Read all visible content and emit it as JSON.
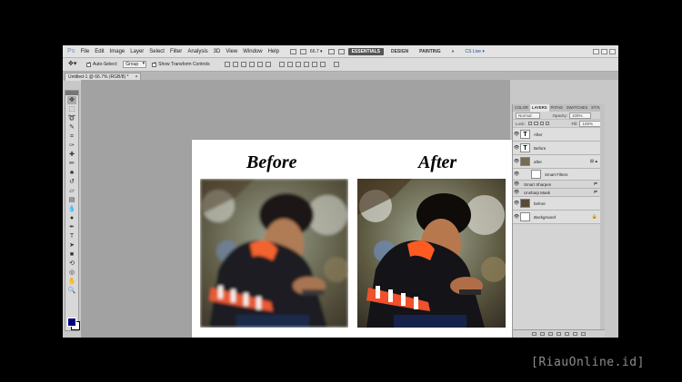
{
  "app": {
    "logo": "Ps",
    "menu": [
      "File",
      "Edit",
      "Image",
      "Layer",
      "Select",
      "Filter",
      "Analysis",
      "3D",
      "View",
      "Window",
      "Help"
    ],
    "zoom": "66.7",
    "workspaces": [
      "ESSENTIALS",
      "DESIGN",
      "PAINTING",
      "»"
    ],
    "cs_live": "CS Live ▾"
  },
  "options": {
    "auto_select_label": "Auto-Select:",
    "auto_select_value": "Group",
    "show_transform_label": "Show Transform Controls"
  },
  "document": {
    "tab_title": "Untitled-1 @ 66.7% (RGB/8) *",
    "before_caption": "Before",
    "after_caption": "After"
  },
  "layers_panel": {
    "tabs": [
      "COLOR",
      "LAYERS",
      "PATHS",
      "SWATCHES",
      "STYLES"
    ],
    "active_tab": "LAYERS",
    "blend_mode": "Normal",
    "opacity_label": "Opacity:",
    "opacity": "100%",
    "lock_label": "Lock:",
    "fill_label": "Fill:",
    "fill": "100%",
    "layers": [
      {
        "name": "After",
        "thumb": "T"
      },
      {
        "name": "Before",
        "thumb": "T"
      },
      {
        "name": "after",
        "thumb": ""
      }
    ],
    "smart_filters": "Smart Filters",
    "filters": [
      "Smart Sharpen",
      "Unsharp Mask"
    ],
    "layers_bottom": [
      {
        "name": "before"
      },
      {
        "name": "Background"
      }
    ]
  },
  "watermark": "[RiauOnline.id]",
  "colors": {
    "foreground": "#000080",
    "background": "#ffffff",
    "active_workspace": "#555555"
  }
}
